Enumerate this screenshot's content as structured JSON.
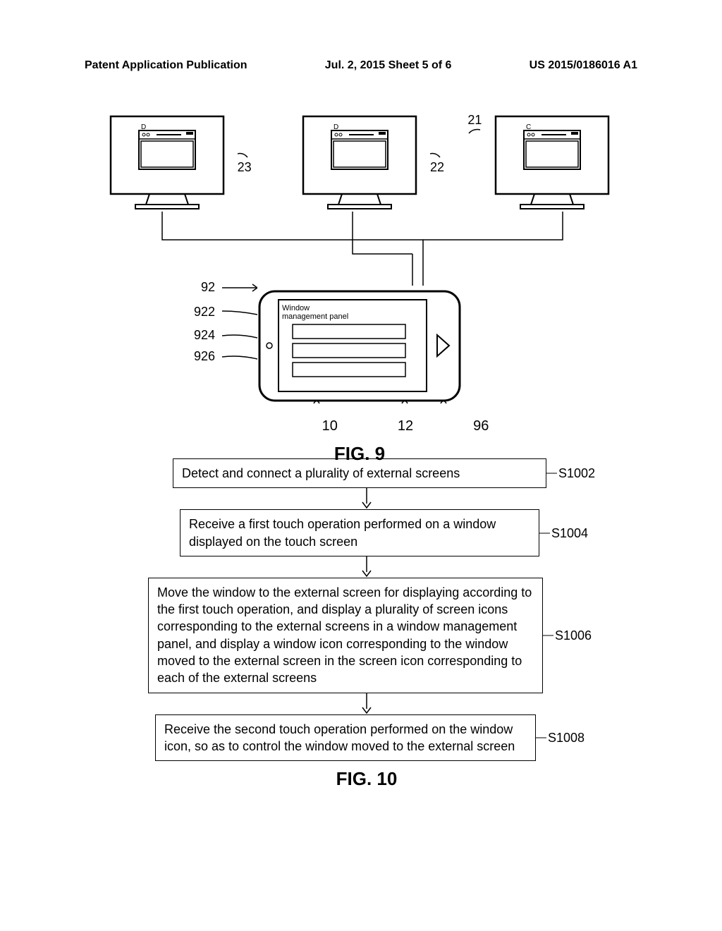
{
  "header": {
    "left": "Patent Application Publication",
    "middle": "Jul. 2, 2015  Sheet 5 of 6",
    "right": "US 2015/0186016 A1"
  },
  "fig9": {
    "title": "FIG. 9",
    "monitor_labels": {
      "left": "23",
      "middle": "22",
      "right": "21"
    },
    "tablet_labels": {
      "top": "92",
      "panel_title": "922",
      "row1": "924",
      "row2": "926"
    },
    "panel_text": "Window\nmanagement panel",
    "bottom_labels": {
      "left": "10",
      "middle": "12",
      "right": "96"
    }
  },
  "fig10": {
    "title": "FIG. 10",
    "steps": [
      {
        "text": "Detect and connect a plurality of external screens",
        "label": "S1002"
      },
      {
        "text": "Receive a first touch operation performed on a window displayed on the touch screen",
        "label": "S1004"
      },
      {
        "text": "Move the window to the external screen for displaying according to the first touch operation, and display a plurality of screen icons corresponding to the external screens in a window management panel, and display a window icon corresponding to the window moved to the external screen in the screen icon corresponding to each of the external screens",
        "label": "S1006"
      },
      {
        "text": "Receive the second touch operation performed on the window icon, so as to control the window moved to the external screen",
        "label": "S1008"
      }
    ]
  }
}
